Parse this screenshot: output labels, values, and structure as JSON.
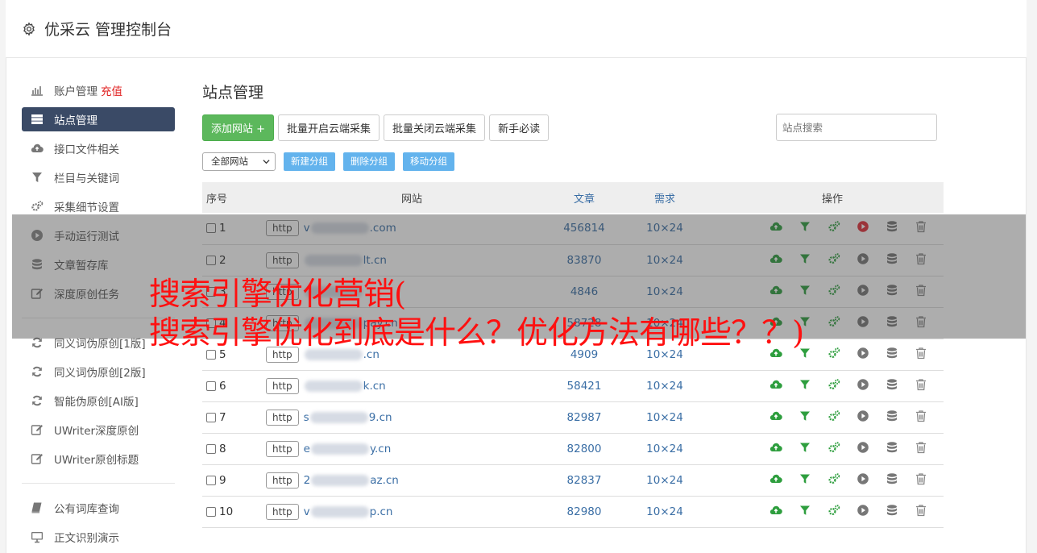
{
  "app": {
    "title": "优采云 管理控制台"
  },
  "sidebar": {
    "items": [
      {
        "label": "账户管理",
        "extra": "充值",
        "icon": "bar-chart-icon"
      },
      {
        "label": "站点管理",
        "icon": "server-list-icon",
        "active": true
      },
      {
        "label": "接口文件相关",
        "icon": "cloud-upload-icon"
      },
      {
        "label": "栏目与关键词",
        "icon": "filter-icon"
      },
      {
        "label": "采集细节设置",
        "icon": "gears-icon"
      },
      {
        "label": "手动运行测试",
        "icon": "play-circle-icon"
      },
      {
        "label": "文章暂存库",
        "icon": "database-icon"
      },
      {
        "label": "深度原创任务",
        "icon": "edit-icon"
      }
    ],
    "group2": [
      {
        "label": "同义词伪原创[1版]",
        "icon": "refresh-icon"
      },
      {
        "label": "同义词伪原创[2版]",
        "icon": "refresh-icon"
      },
      {
        "label": "智能伪原创[AI版]",
        "icon": "refresh-icon"
      },
      {
        "label": "UWriter深度原创",
        "icon": "edit-icon"
      },
      {
        "label": "UWriter原创标题",
        "icon": "edit-icon"
      }
    ],
    "group3": [
      {
        "label": "公有词库查询",
        "icon": "book-icon"
      },
      {
        "label": "正文识别演示",
        "icon": "monitor-icon"
      }
    ]
  },
  "main": {
    "title": "站点管理",
    "add_site": "添加网站 +",
    "batch_open": "批量开启云端采集",
    "batch_close": "批量关闭云端采集",
    "newbie": "新手必读",
    "search_placeholder": "站点搜索",
    "group_select": "全部网站",
    "new_group": "新建分组",
    "delete_group": "删除分组",
    "move_group": "移动分组"
  },
  "table": {
    "headers": {
      "no": "序号",
      "site": "网站",
      "articles": "文章",
      "need": "需求",
      "ops": "操作"
    },
    "rows": [
      {
        "no": "1",
        "scheme": "http",
        "pre": "v",
        "post": ".com",
        "articles": "456814",
        "need": "10×24",
        "run_active": true
      },
      {
        "no": "2",
        "scheme": "http",
        "pre": "",
        "post": "lt.cn",
        "articles": "83870",
        "need": "10×24"
      },
      {
        "no": "3",
        "scheme": "http",
        "pre": "",
        "post": "",
        "articles": "4846",
        "need": "10×24"
      },
      {
        "no": "4",
        "scheme": "http",
        "pre": "",
        "post": "pay.cn",
        "articles": "58728",
        "need": "10×24"
      },
      {
        "no": "5",
        "scheme": "http",
        "pre": "",
        "post": ".cn",
        "articles": "4909",
        "need": "10×24"
      },
      {
        "no": "6",
        "scheme": "http",
        "pre": "",
        "post": "k.cn",
        "articles": "58421",
        "need": "10×24"
      },
      {
        "no": "7",
        "scheme": "http",
        "pre": "s",
        "post": "9.cn",
        "articles": "82987",
        "need": "10×24"
      },
      {
        "no": "8",
        "scheme": "http",
        "pre": "e",
        "post": "y.cn",
        "articles": "82800",
        "need": "10×24"
      },
      {
        "no": "9",
        "scheme": "http",
        "pre": "2",
        "post": "az.cn",
        "articles": "82837",
        "need": "10×24"
      },
      {
        "no": "10",
        "scheme": "http",
        "pre": "v",
        "post": "p.cn",
        "articles": "82980",
        "need": "10×24"
      }
    ]
  },
  "overlay": {
    "line1": "搜索引擎优化营销(",
    "line2": "搜索引擎优化到底是什么？优化方法有哪些？？)"
  },
  "colors": {
    "accent": "#3a4a66",
    "green": "#5cb85c",
    "link": "#3a6ea5",
    "headline": "#ff1010"
  }
}
